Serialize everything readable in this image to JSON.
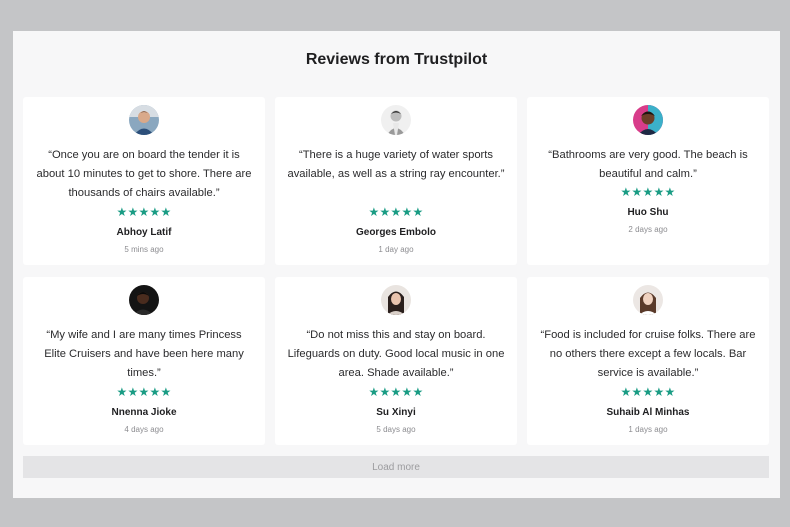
{
  "section": {
    "title": "Reviews from Trustpilot"
  },
  "reviews": [
    {
      "quote": "“Once you are on board the tender it is about 10 minutes to get to shore. There are thousands of chairs available.”",
      "stars": 5,
      "name": "Abhoy Latif",
      "time": "5 mins ago",
      "avatar": "person-avatar-icon"
    },
    {
      "quote": "“There is a huge variety of water sports available, as well as a string ray encounter.”",
      "stars": 5,
      "name": "Georges Embolo",
      "time": "1 day ago",
      "avatar": "person-avatar-icon"
    },
    {
      "quote": "“Bathrooms are very good. The beach is beautiful and calm.”",
      "stars": 5,
      "name": "Huo Shu",
      "time": "2 days ago",
      "avatar": "person-avatar-icon"
    },
    {
      "quote": "“My wife and I are many times Princess Elite Cruisers and have been here many times.”",
      "stars": 5,
      "name": "Nnenna Jioke",
      "time": "4 days ago",
      "avatar": "person-avatar-icon"
    },
    {
      "quote": "“Do not miss this and stay on board. Lifeguards on duty. Good local music in one area. Shade available.”",
      "stars": 5,
      "name": "Su Xinyi",
      "time": "5 days ago",
      "avatar": "person-avatar-icon"
    },
    {
      "quote": "“Food is included for cruise folks. There are no others there except a few locals. Bar service is available.”",
      "stars": 5,
      "name": "Suhaib Al Minhas",
      "time": "1 days ago",
      "avatar": "person-avatar-icon"
    }
  ],
  "load_more": {
    "label": "Load more"
  },
  "colors": {
    "star": "#1a9c84",
    "background": "#c4c5c7",
    "panel": "#f7f7f8",
    "card": "#ffffff",
    "button": "#e4e4e6"
  }
}
